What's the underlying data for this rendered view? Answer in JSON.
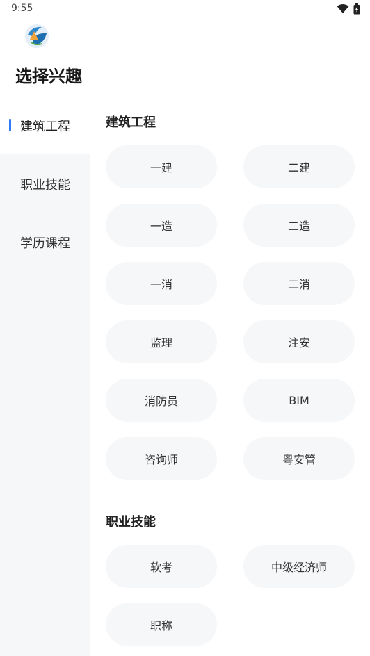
{
  "status_bar": {
    "time": "9:55"
  },
  "title": "选择兴趣",
  "sidebar": [
    {
      "label": "建筑工程",
      "active": true
    },
    {
      "label": "职业技能",
      "active": false
    },
    {
      "label": "学历课程",
      "active": false
    }
  ],
  "sections": [
    {
      "title": "建筑工程",
      "items": [
        "一建",
        "二建",
        "一造",
        "二造",
        "一消",
        "二消",
        "监理",
        "注安",
        "消防员",
        "BIM",
        "咨询师",
        "粤安管"
      ]
    },
    {
      "title": "职业技能",
      "items": [
        "软考",
        "中级经济师",
        "职称"
      ]
    }
  ],
  "colors": {
    "accent": "#2f7df6",
    "chip_bg": "#f6f7f9",
    "sidebar_bg": "#f6f7f9"
  }
}
